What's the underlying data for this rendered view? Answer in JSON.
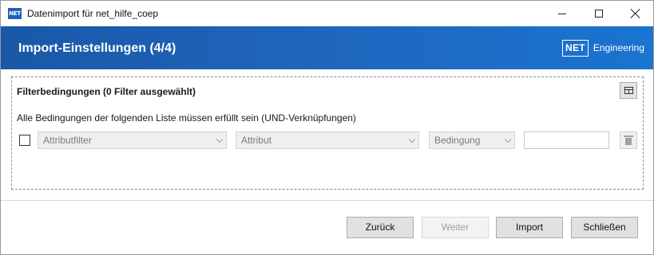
{
  "window": {
    "icon_label": "NET",
    "title": "Datenimport für net_hilfe_coep"
  },
  "banner": {
    "title": "Import-Einstellungen (4/4)",
    "brand_badge": "NET",
    "brand_text": "Engineering"
  },
  "filter": {
    "heading": "Filterbedingungen (0 Filter ausgewählt)",
    "hint": "Alle Bedingungen der folgenden Liste müssen erfüllt sein (UND-Verknüpfungen)",
    "row": {
      "checked": false,
      "attribute_filter": "Attributfilter",
      "attribute": "Attribut",
      "condition": "Bedingung",
      "value": ""
    }
  },
  "footer": {
    "back_label": "Zurück",
    "next_label": "Weiter",
    "import_label": "Import",
    "close_label": "Schließen"
  }
}
